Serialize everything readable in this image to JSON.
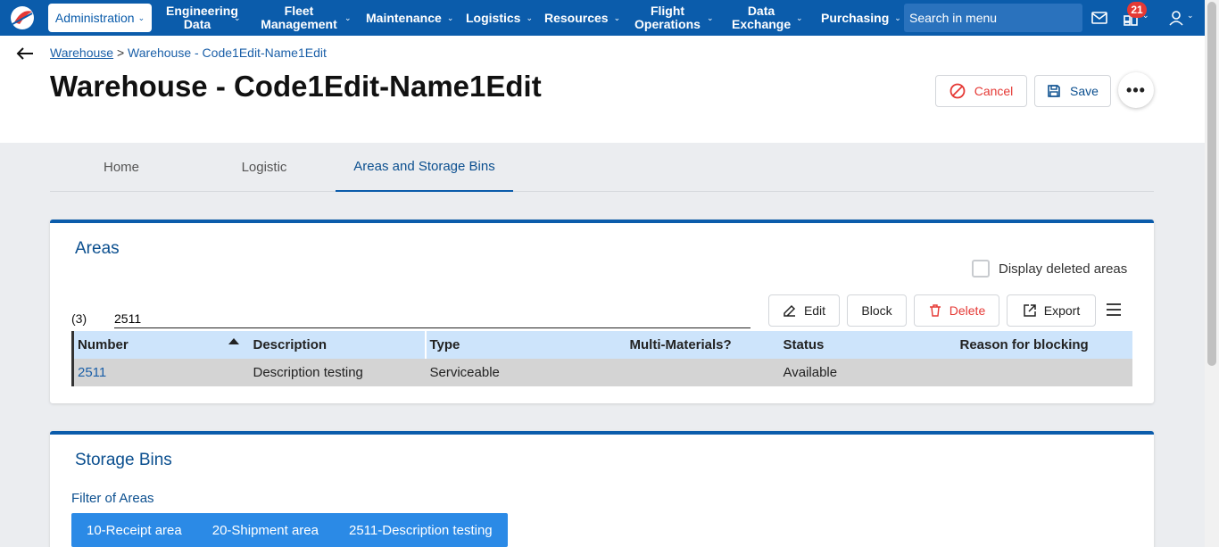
{
  "nav": {
    "admin": "Administration",
    "items": [
      {
        "label": "Engineering Data"
      },
      {
        "label": "Fleet Management"
      },
      {
        "label": "Maintenance"
      },
      {
        "label": "Logistics"
      },
      {
        "label": "Resources"
      },
      {
        "label": "Flight Operations"
      },
      {
        "label": "Data Exchange"
      },
      {
        "label": "Purchasing"
      }
    ],
    "search_placeholder": "Search in menu",
    "notification_count": "21"
  },
  "breadcrumb": {
    "parent": "Warehouse",
    "separator": ">",
    "current": "Warehouse - Code1Edit-Name1Edit"
  },
  "page_title": "Warehouse - Code1Edit-Name1Edit",
  "actions": {
    "cancel": "Cancel",
    "save": "Save",
    "more": "•••"
  },
  "tabs": [
    {
      "label": "Home",
      "active": false
    },
    {
      "label": "Logistic",
      "active": false
    },
    {
      "label": "Areas and Storage Bins",
      "active": true
    }
  ],
  "areas": {
    "title": "Areas",
    "display_deleted_label": "Display deleted areas",
    "display_deleted_checked": false,
    "count": "(3)",
    "filter_value": "2511",
    "toolbar": {
      "edit": "Edit",
      "block": "Block",
      "delete": "Delete",
      "export": "Export"
    },
    "columns": [
      "Number",
      "Description",
      "Type",
      "Multi-Materials?",
      "Status",
      "Reason for blocking"
    ],
    "rows": [
      {
        "number": "2511",
        "description": "Description testing",
        "type": "Serviceable",
        "multi": "",
        "status": "Available",
        "reason": ""
      }
    ]
  },
  "storage_bins": {
    "title": "Storage Bins",
    "filter_label": "Filter of Areas",
    "area_filters": [
      "10-Receipt area",
      "20-Shipment area",
      "2511-Description testing"
    ]
  },
  "colors": {
    "brand": "#0b5cab",
    "danger": "#e53935",
    "chip": "#2b8ae6"
  }
}
